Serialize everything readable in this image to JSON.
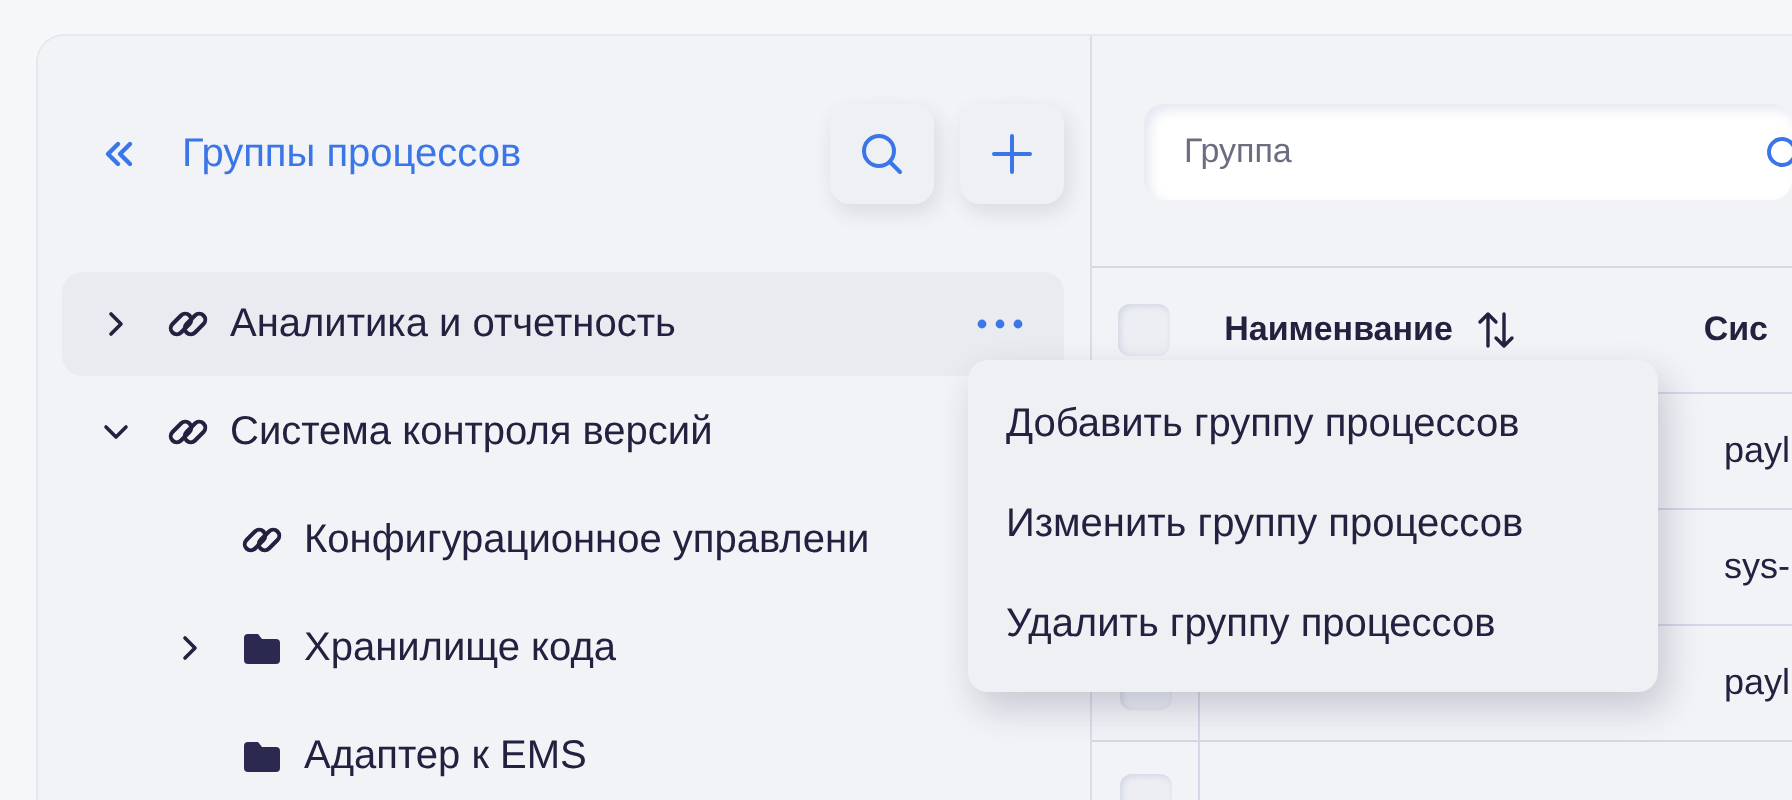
{
  "sidebar": {
    "title": "Группы процессов",
    "tree": [
      {
        "label": "Аналитика и отчетность",
        "kind": "link",
        "expanded": false,
        "menu_open": true
      },
      {
        "label": "Система контроля версий",
        "kind": "link",
        "expanded": true,
        "menu_open": false,
        "children": [
          {
            "label": "Конфигурационное управлени",
            "kind": "link"
          },
          {
            "label": "Хранилище кода",
            "kind": "folder",
            "expanded": false
          },
          {
            "label": "Адаптер к EMS",
            "kind": "folder"
          }
        ]
      }
    ]
  },
  "context_menu": {
    "items": [
      "Добавить группу процессов",
      "Изменить группу процессов",
      "Удалить группу процессов"
    ]
  },
  "filter": {
    "placeholder": "Группа"
  },
  "table": {
    "all_checked": false,
    "columns": [
      {
        "label": "Наименвание",
        "sortable": true
      },
      {
        "label": "Сис"
      }
    ],
    "rows": [
      {
        "column_2": "payl"
      },
      {
        "column_2": "sys-"
      },
      {
        "checked": false,
        "column_2": "payl"
      },
      {
        "checked": false
      }
    ]
  }
}
